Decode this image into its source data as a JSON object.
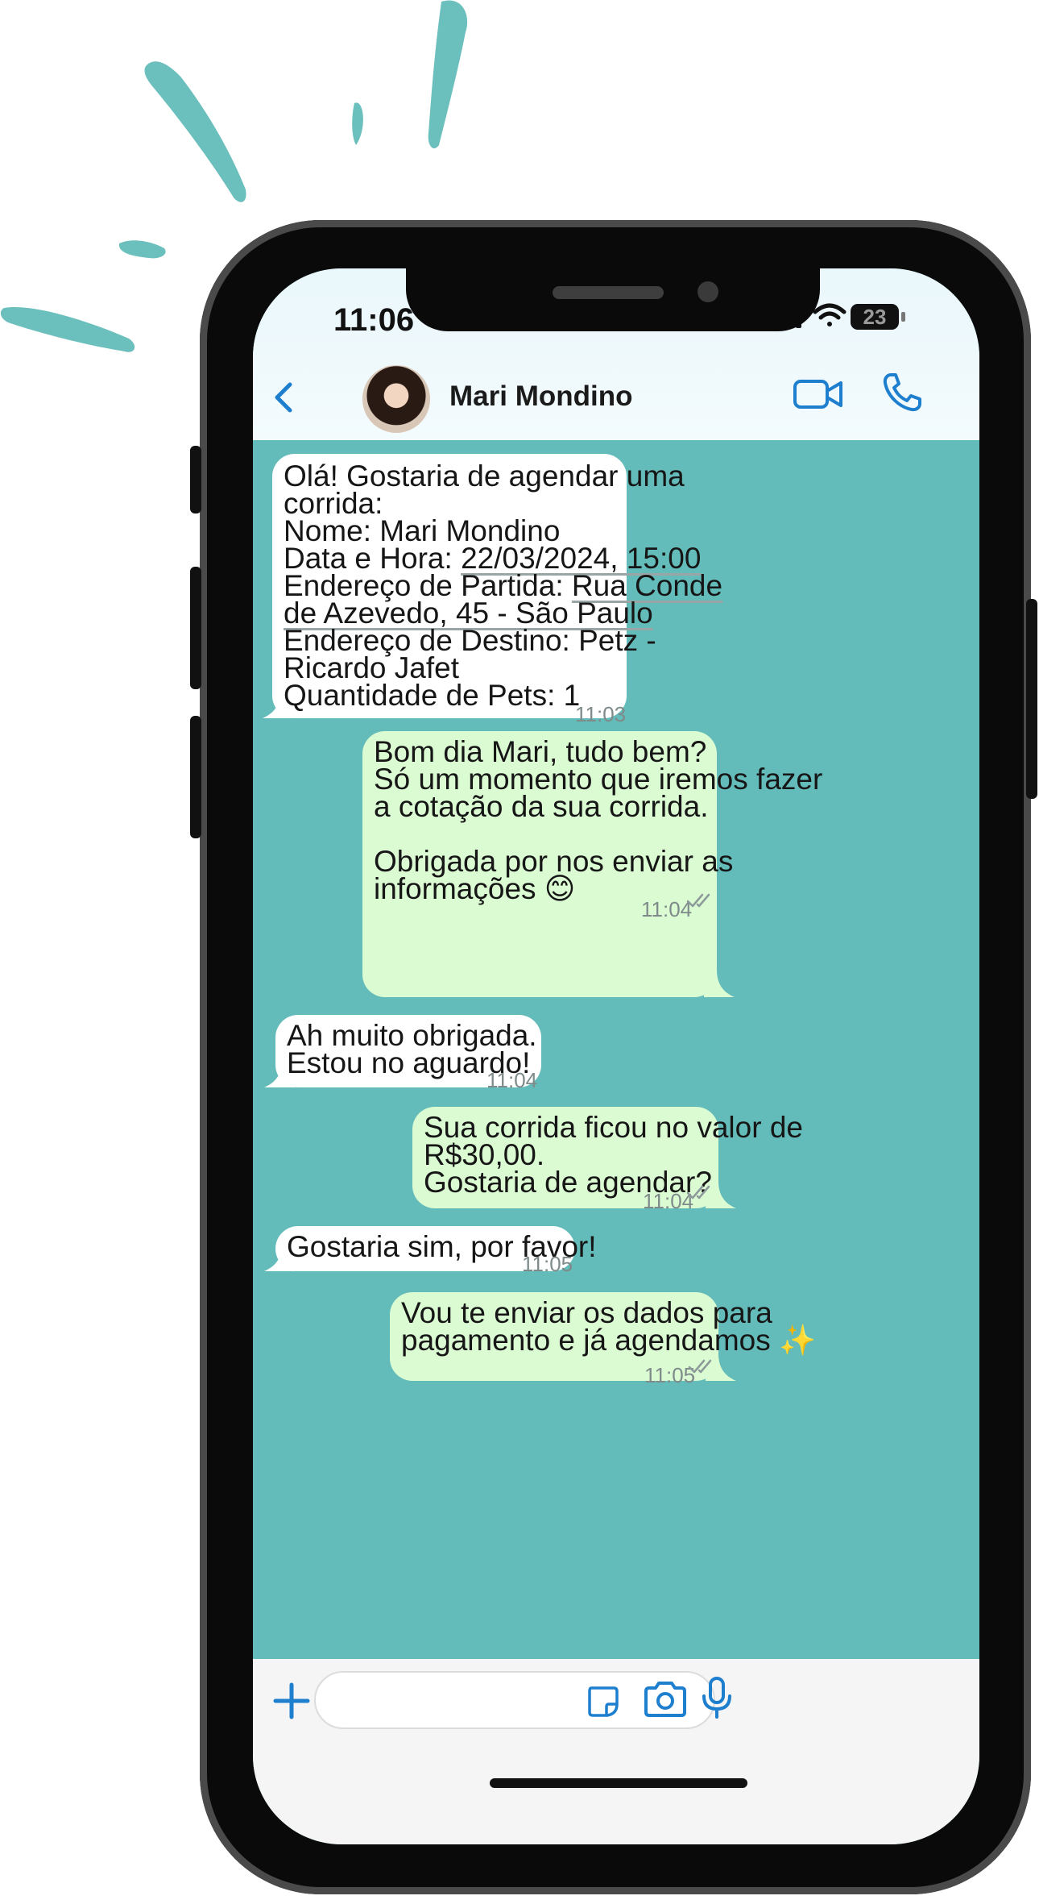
{
  "colors": {
    "chat_background": "#64bcba",
    "incoming_bubble": "#ffffff",
    "outgoing_bubble": "#dbfbd3",
    "accent_blue": "#1e7fcf",
    "decoration": "#6bbfbd"
  },
  "status_bar": {
    "time": "11:06",
    "battery": "23",
    "icons": [
      "signal-icon",
      "wifi-icon",
      "battery-icon"
    ]
  },
  "header": {
    "back_icon": "chevron-left-icon",
    "contact_name": "Mari Mondino",
    "video_icon": "video-camera-icon",
    "call_icon": "phone-icon"
  },
  "messages": [
    {
      "direction": "in",
      "lines": [
        "Olá! Gostaria de agendar uma",
        "corrida:",
        "Nome: Mari Mondino",
        "Data e Hora: ",
        "22/03/2024, 15:00",
        "Endereço de Partida: ",
        "Rua Conde",
        "de Azevedo, 45 - São Paulo",
        "Endereço de Destino: Petz -",
        "Ricardo Jafet",
        "Quantidade de Pets: 1"
      ],
      "time": "11:03"
    },
    {
      "direction": "out",
      "lines": [
        "Bom dia Mari, tudo bem?",
        "Só um momento que iremos fazer",
        "a cotação da sua corrida.",
        "",
        "Obrigada por nos enviar as",
        "informações 😊"
      ],
      "time": "11:04",
      "read": true
    },
    {
      "direction": "in",
      "lines": [
        "Ah muito obrigada.",
        "Estou no aguardo!"
      ],
      "time": "11:04"
    },
    {
      "direction": "out",
      "lines": [
        "Sua corrida ficou no valor de",
        "R$30,00.",
        "Gostaria de agendar?"
      ],
      "time": "11:04",
      "read": true
    },
    {
      "direction": "in",
      "lines": [
        "Gostaria sim, por favor!"
      ],
      "time": "11:05"
    },
    {
      "direction": "out",
      "lines": [
        "Vou te enviar os dados para",
        "pagamento e já agendamos ✨"
      ],
      "time": "11:05",
      "read": true
    }
  ],
  "composer": {
    "plus_icon": "plus-icon",
    "message_value": "",
    "sticker_icon": "sticker-icon",
    "camera_icon": "camera-icon",
    "mic_icon": "microphone-icon"
  }
}
